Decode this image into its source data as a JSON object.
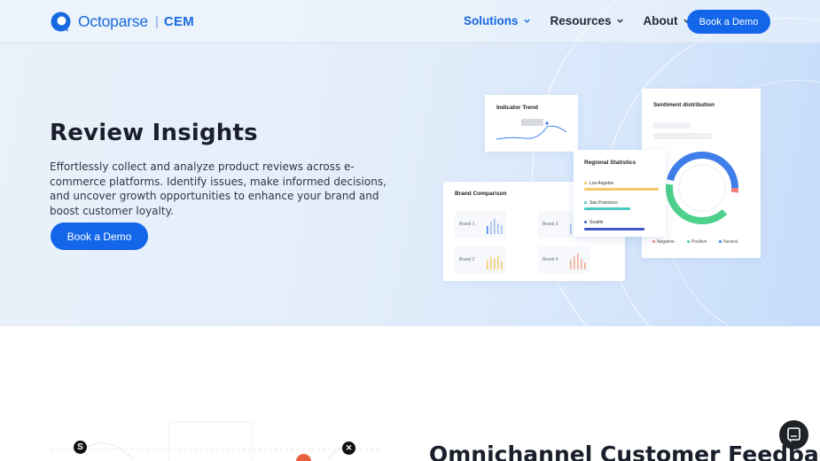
{
  "brand": {
    "name": "Octoparse",
    "sub": "CEM",
    "color": "#1769e0"
  },
  "nav": {
    "items": [
      {
        "label": "Solutions",
        "active": true
      },
      {
        "label": "Resources",
        "active": false
      },
      {
        "label": "About",
        "active": false
      }
    ],
    "cta_label": "Book a Demo"
  },
  "hero": {
    "title": "Review Insights",
    "description": "Effortlessly collect and analyze product reviews across e-commerce platforms. Identify issues, make informed decisions, and uncover growth opportunities to enhance your brand and boost customer loyalty.",
    "cta_label": "Book a Demo"
  },
  "illustration": {
    "trend_title": "Indicator Trend",
    "sentiment_title": "Sentiment distribution",
    "sentiment_legend": [
      "Negative",
      "Positive",
      "Neutral"
    ],
    "brand_title": "Brand Comparison",
    "brands": [
      "Brand 1",
      "Brand 3",
      "Brand 2",
      "Brand 4"
    ],
    "regional_title": "Regional Statistics",
    "regions": [
      "Los Angeles",
      "San Francisco",
      "Seattle"
    ]
  },
  "lower": {
    "title": "Omnichannel Customer Feedback"
  },
  "colors": {
    "primary": "#1366ea",
    "negative": "#f07a7a",
    "positive": "#4cd08a",
    "neutral": "#3f7ee8"
  },
  "icons": [
    "chevron-down-icon",
    "chat-icon",
    "octoparse-logo-icon",
    "x-icon",
    "s-icon"
  ]
}
